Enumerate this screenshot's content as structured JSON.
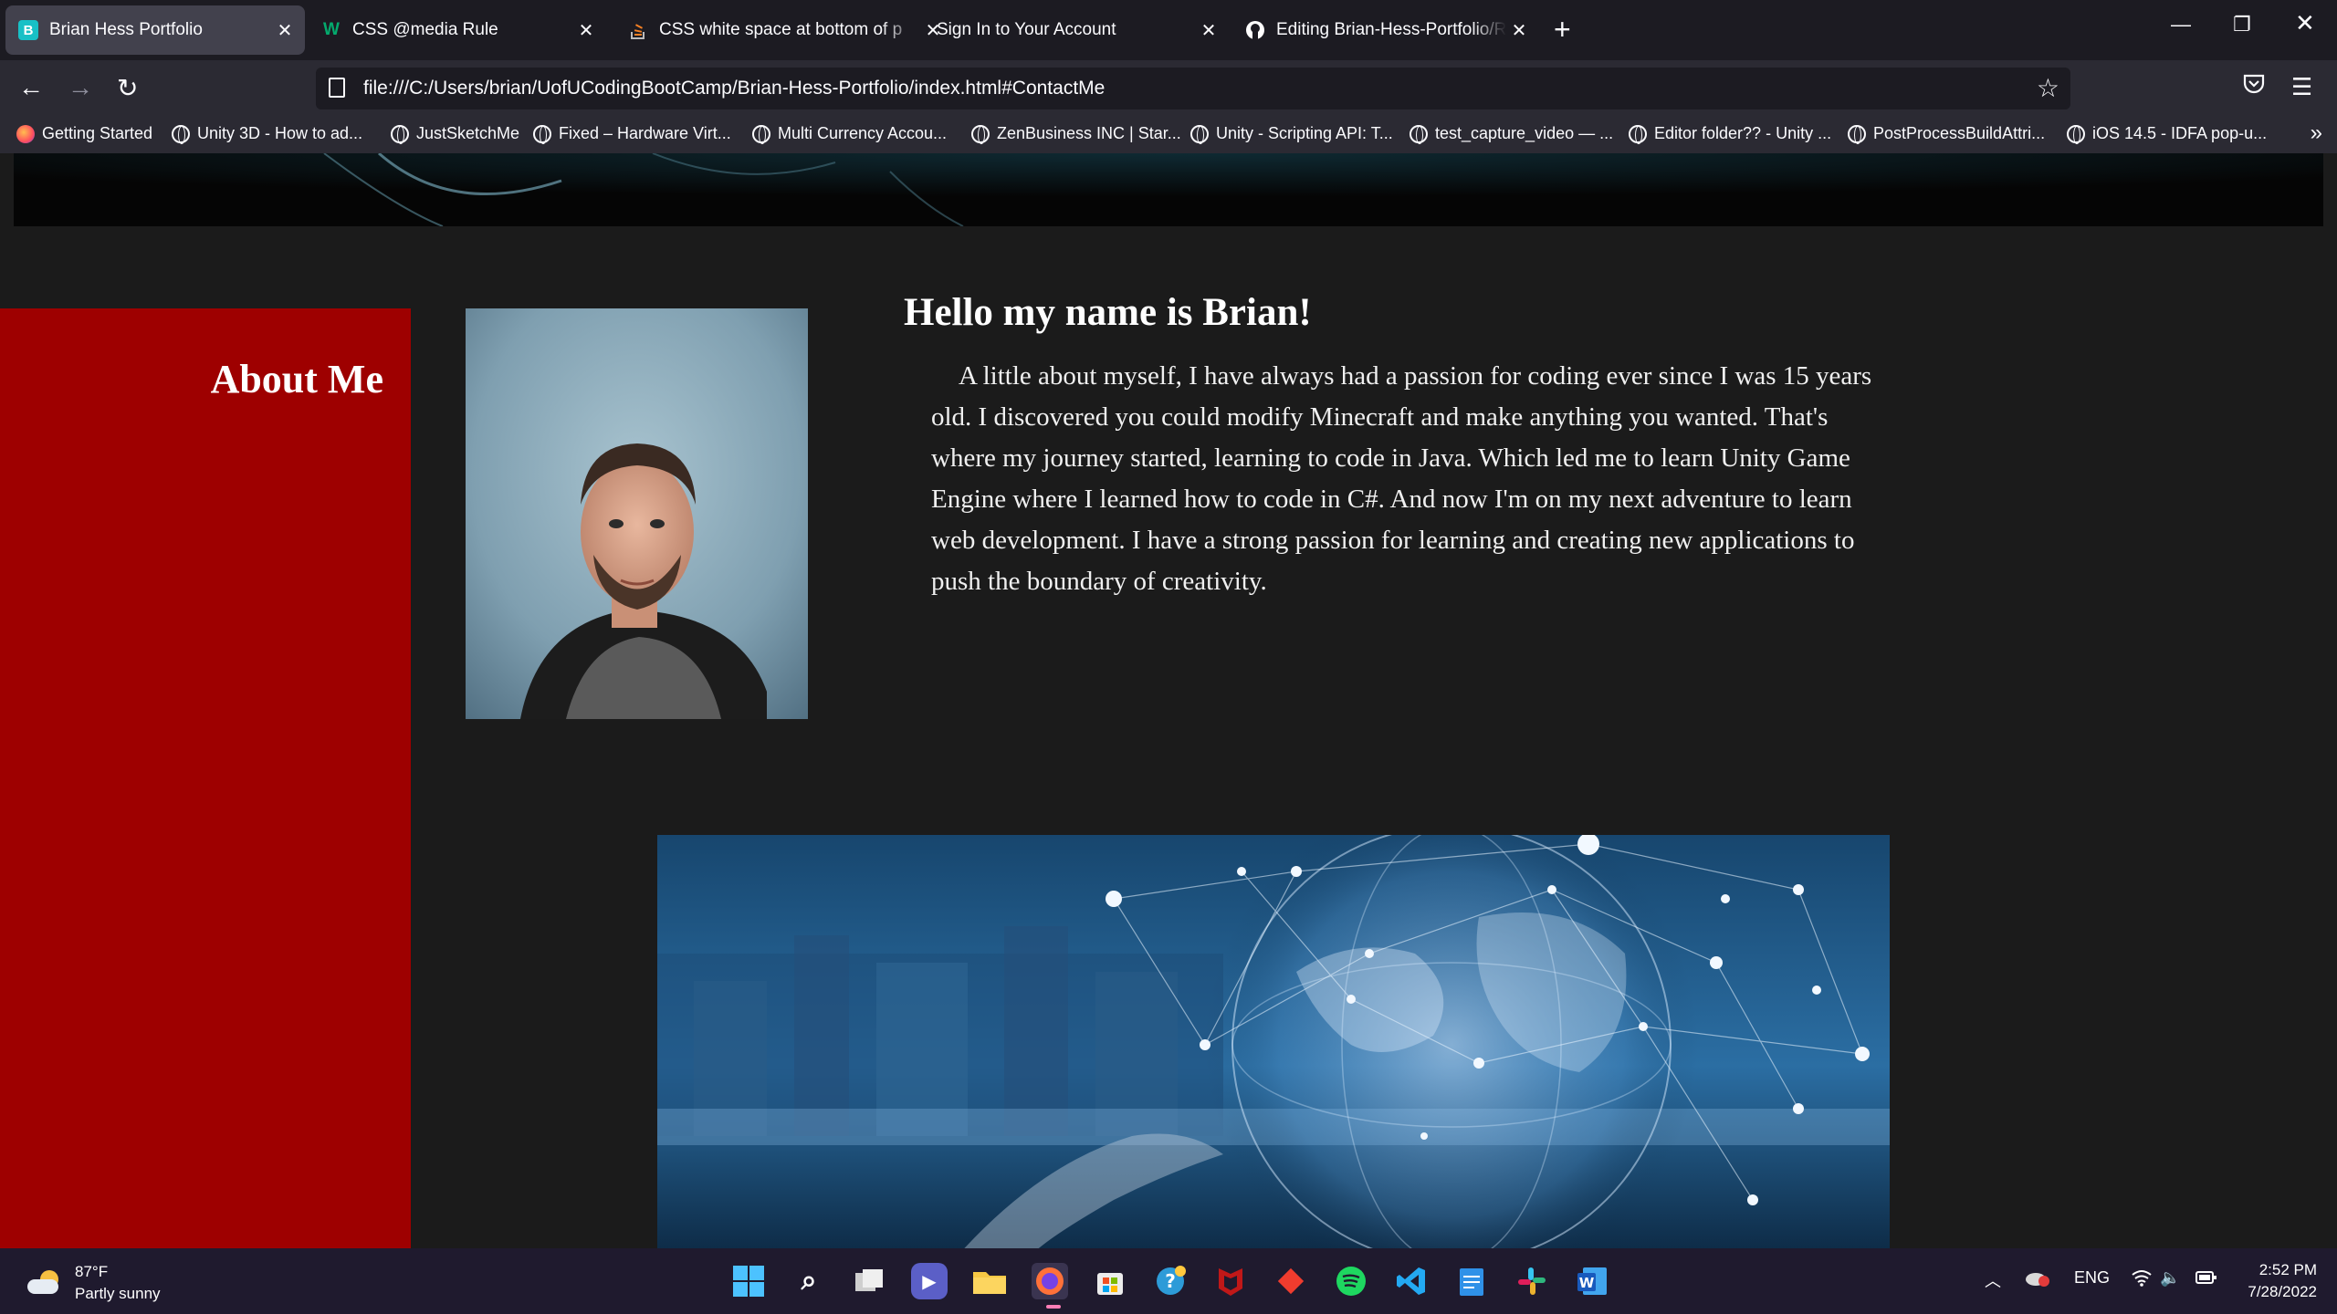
{
  "browser": {
    "tabs": [
      {
        "title": "Brian Hess Portfolio",
        "favicon": "B",
        "favicon_color": "#18c0c6",
        "active": true
      },
      {
        "title": "CSS @media Rule",
        "favicon": "W",
        "favicon_color": "#04aa6d",
        "active": false
      },
      {
        "title": "CSS white space at bottom of p",
        "favicon": "stack-overflow-icon",
        "favicon_color": "#f48024",
        "active": false
      },
      {
        "title": "Sign In to Your Account",
        "favicon": "",
        "favicon_color": "",
        "active": false
      },
      {
        "title": "Editing Brian-Hess-Portfolio/RE",
        "favicon": "github-icon",
        "favicon_color": "#ffffff",
        "active": false
      }
    ],
    "url": "file:///C:/Users/brian/UofUCodingBootCamp/Brian-Hess-Portfolio/index.html#ContactMe",
    "bookmarks": [
      "Getting Started",
      "Unity 3D - How to ad...",
      "JustSketchMe",
      "Fixed – Hardware Virt...",
      "Multi Currency Accou...",
      "ZenBusiness INC | Star...",
      "Unity - Scripting API: T...",
      "test_capture_video — ...",
      "Editor folder?? - Unity ...",
      "PostProcessBuildAttri...",
      "iOS 14.5 - IDFA pop-u..."
    ]
  },
  "page": {
    "about_title": "About Me",
    "greeting": "Hello my name is Brian!",
    "about_body": "A little about myself, I have always had a passion for coding ever since I was 15 years old. I discovered you could modify Minecraft and make anything you wanted. That's where my journey started, learning to code in Java. Which led me to learn Unity Game Engine where I learned how to code in C#. And now I'm on my next adventure to learn web development. I have a strong passion for learning and creating new applications to push the boundary of creativity.",
    "accent_color": "#9e0000"
  },
  "taskbar": {
    "weather_temp": "87°F",
    "weather_desc": "Partly sunny",
    "language": "ENG",
    "time": "2:52 PM",
    "date": "7/28/2022"
  }
}
